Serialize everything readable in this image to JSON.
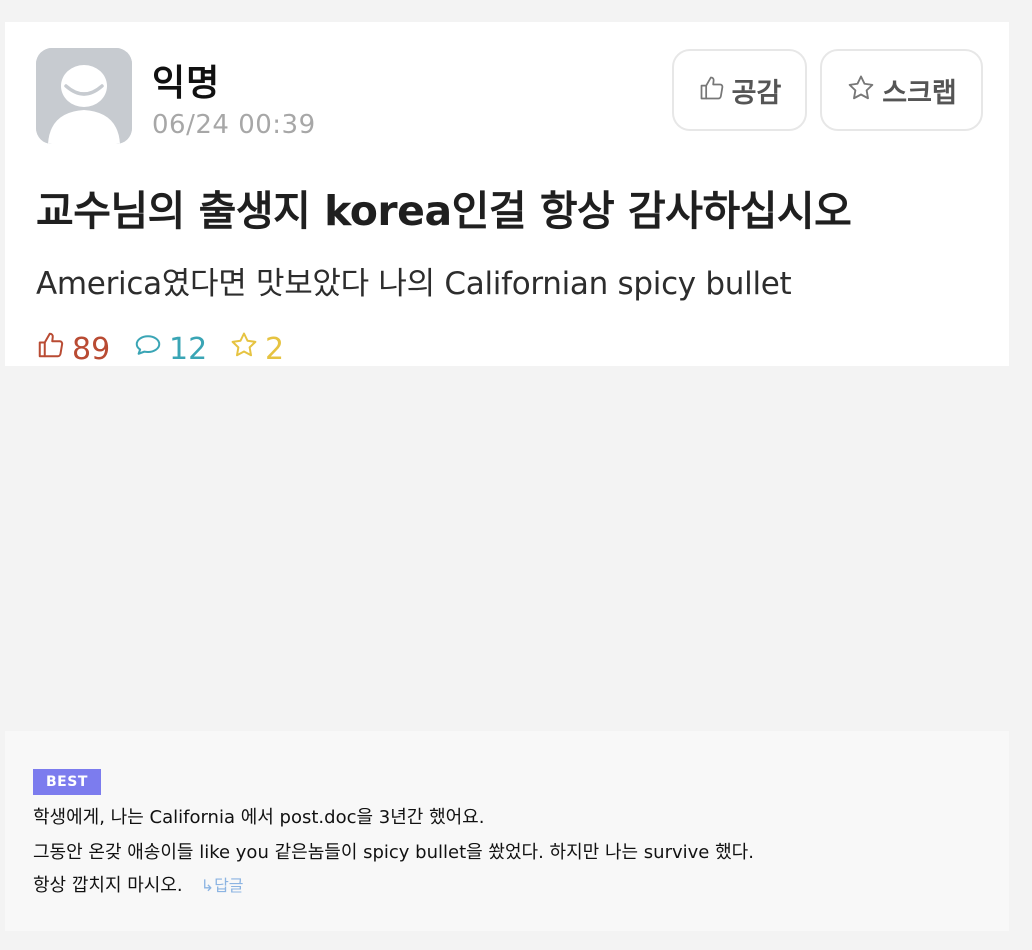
{
  "post": {
    "author": "익명",
    "date": "06/24 00:39",
    "title": "교수님의 출생지 korea인걸 항상 감사하십시오",
    "body": "America였다면 맛보았다 나의 Californian spicy bullet",
    "actions": {
      "like_label": "공감",
      "scrap_label": "스크랩"
    },
    "stats": {
      "likes": "89",
      "comments": "12",
      "scraps": "2"
    }
  },
  "comment": {
    "badge": "BEST",
    "lines": [
      "학생에게, 나는 California 에서 post.doc을 3년간 했어요.",
      "그동안 온갖 애송이들 like you 같은놈들이 spicy bullet을 쐈었다. 하지만 나는 survive 했다.",
      "항상 깝치지 마시오."
    ],
    "reply_label": "↳답글"
  },
  "colors": {
    "like": "#b94b33",
    "comment": "#3aa5b5",
    "scrap": "#e6c341",
    "badge": "#7c7cee",
    "reply": "#8cb4e2"
  },
  "icons": {
    "avatar": "anonymous-avatar-icon",
    "like": "thumbs-up-icon",
    "scrap": "star-icon",
    "comment": "speech-bubble-icon"
  }
}
